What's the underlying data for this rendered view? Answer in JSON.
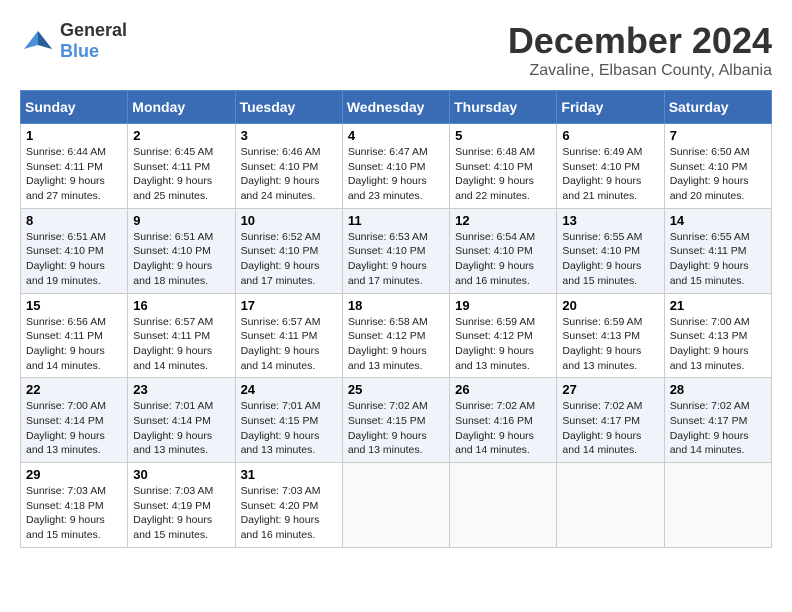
{
  "logo": {
    "general": "General",
    "blue": "Blue"
  },
  "title": "December 2024",
  "location": "Zavaline, Elbasan County, Albania",
  "days_header": [
    "Sunday",
    "Monday",
    "Tuesday",
    "Wednesday",
    "Thursday",
    "Friday",
    "Saturday"
  ],
  "weeks": [
    [
      {
        "day": "1",
        "sunrise": "Sunrise: 6:44 AM",
        "sunset": "Sunset: 4:11 PM",
        "daylight": "Daylight: 9 hours and 27 minutes."
      },
      {
        "day": "2",
        "sunrise": "Sunrise: 6:45 AM",
        "sunset": "Sunset: 4:11 PM",
        "daylight": "Daylight: 9 hours and 25 minutes."
      },
      {
        "day": "3",
        "sunrise": "Sunrise: 6:46 AM",
        "sunset": "Sunset: 4:10 PM",
        "daylight": "Daylight: 9 hours and 24 minutes."
      },
      {
        "day": "4",
        "sunrise": "Sunrise: 6:47 AM",
        "sunset": "Sunset: 4:10 PM",
        "daylight": "Daylight: 9 hours and 23 minutes."
      },
      {
        "day": "5",
        "sunrise": "Sunrise: 6:48 AM",
        "sunset": "Sunset: 4:10 PM",
        "daylight": "Daylight: 9 hours and 22 minutes."
      },
      {
        "day": "6",
        "sunrise": "Sunrise: 6:49 AM",
        "sunset": "Sunset: 4:10 PM",
        "daylight": "Daylight: 9 hours and 21 minutes."
      },
      {
        "day": "7",
        "sunrise": "Sunrise: 6:50 AM",
        "sunset": "Sunset: 4:10 PM",
        "daylight": "Daylight: 9 hours and 20 minutes."
      }
    ],
    [
      {
        "day": "8",
        "sunrise": "Sunrise: 6:51 AM",
        "sunset": "Sunset: 4:10 PM",
        "daylight": "Daylight: 9 hours and 19 minutes."
      },
      {
        "day": "9",
        "sunrise": "Sunrise: 6:51 AM",
        "sunset": "Sunset: 4:10 PM",
        "daylight": "Daylight: 9 hours and 18 minutes."
      },
      {
        "day": "10",
        "sunrise": "Sunrise: 6:52 AM",
        "sunset": "Sunset: 4:10 PM",
        "daylight": "Daylight: 9 hours and 17 minutes."
      },
      {
        "day": "11",
        "sunrise": "Sunrise: 6:53 AM",
        "sunset": "Sunset: 4:10 PM",
        "daylight": "Daylight: 9 hours and 17 minutes."
      },
      {
        "day": "12",
        "sunrise": "Sunrise: 6:54 AM",
        "sunset": "Sunset: 4:10 PM",
        "daylight": "Daylight: 9 hours and 16 minutes."
      },
      {
        "day": "13",
        "sunrise": "Sunrise: 6:55 AM",
        "sunset": "Sunset: 4:10 PM",
        "daylight": "Daylight: 9 hours and 15 minutes."
      },
      {
        "day": "14",
        "sunrise": "Sunrise: 6:55 AM",
        "sunset": "Sunset: 4:11 PM",
        "daylight": "Daylight: 9 hours and 15 minutes."
      }
    ],
    [
      {
        "day": "15",
        "sunrise": "Sunrise: 6:56 AM",
        "sunset": "Sunset: 4:11 PM",
        "daylight": "Daylight: 9 hours and 14 minutes."
      },
      {
        "day": "16",
        "sunrise": "Sunrise: 6:57 AM",
        "sunset": "Sunset: 4:11 PM",
        "daylight": "Daylight: 9 hours and 14 minutes."
      },
      {
        "day": "17",
        "sunrise": "Sunrise: 6:57 AM",
        "sunset": "Sunset: 4:11 PM",
        "daylight": "Daylight: 9 hours and 14 minutes."
      },
      {
        "day": "18",
        "sunrise": "Sunrise: 6:58 AM",
        "sunset": "Sunset: 4:12 PM",
        "daylight": "Daylight: 9 hours and 13 minutes."
      },
      {
        "day": "19",
        "sunrise": "Sunrise: 6:59 AM",
        "sunset": "Sunset: 4:12 PM",
        "daylight": "Daylight: 9 hours and 13 minutes."
      },
      {
        "day": "20",
        "sunrise": "Sunrise: 6:59 AM",
        "sunset": "Sunset: 4:13 PM",
        "daylight": "Daylight: 9 hours and 13 minutes."
      },
      {
        "day": "21",
        "sunrise": "Sunrise: 7:00 AM",
        "sunset": "Sunset: 4:13 PM",
        "daylight": "Daylight: 9 hours and 13 minutes."
      }
    ],
    [
      {
        "day": "22",
        "sunrise": "Sunrise: 7:00 AM",
        "sunset": "Sunset: 4:14 PM",
        "daylight": "Daylight: 9 hours and 13 minutes."
      },
      {
        "day": "23",
        "sunrise": "Sunrise: 7:01 AM",
        "sunset": "Sunset: 4:14 PM",
        "daylight": "Daylight: 9 hours and 13 minutes."
      },
      {
        "day": "24",
        "sunrise": "Sunrise: 7:01 AM",
        "sunset": "Sunset: 4:15 PM",
        "daylight": "Daylight: 9 hours and 13 minutes."
      },
      {
        "day": "25",
        "sunrise": "Sunrise: 7:02 AM",
        "sunset": "Sunset: 4:15 PM",
        "daylight": "Daylight: 9 hours and 13 minutes."
      },
      {
        "day": "26",
        "sunrise": "Sunrise: 7:02 AM",
        "sunset": "Sunset: 4:16 PM",
        "daylight": "Daylight: 9 hours and 14 minutes."
      },
      {
        "day": "27",
        "sunrise": "Sunrise: 7:02 AM",
        "sunset": "Sunset: 4:17 PM",
        "daylight": "Daylight: 9 hours and 14 minutes."
      },
      {
        "day": "28",
        "sunrise": "Sunrise: 7:02 AM",
        "sunset": "Sunset: 4:17 PM",
        "daylight": "Daylight: 9 hours and 14 minutes."
      }
    ],
    [
      {
        "day": "29",
        "sunrise": "Sunrise: 7:03 AM",
        "sunset": "Sunset: 4:18 PM",
        "daylight": "Daylight: 9 hours and 15 minutes."
      },
      {
        "day": "30",
        "sunrise": "Sunrise: 7:03 AM",
        "sunset": "Sunset: 4:19 PM",
        "daylight": "Daylight: 9 hours and 15 minutes."
      },
      {
        "day": "31",
        "sunrise": "Sunrise: 7:03 AM",
        "sunset": "Sunset: 4:20 PM",
        "daylight": "Daylight: 9 hours and 16 minutes."
      },
      null,
      null,
      null,
      null
    ]
  ]
}
